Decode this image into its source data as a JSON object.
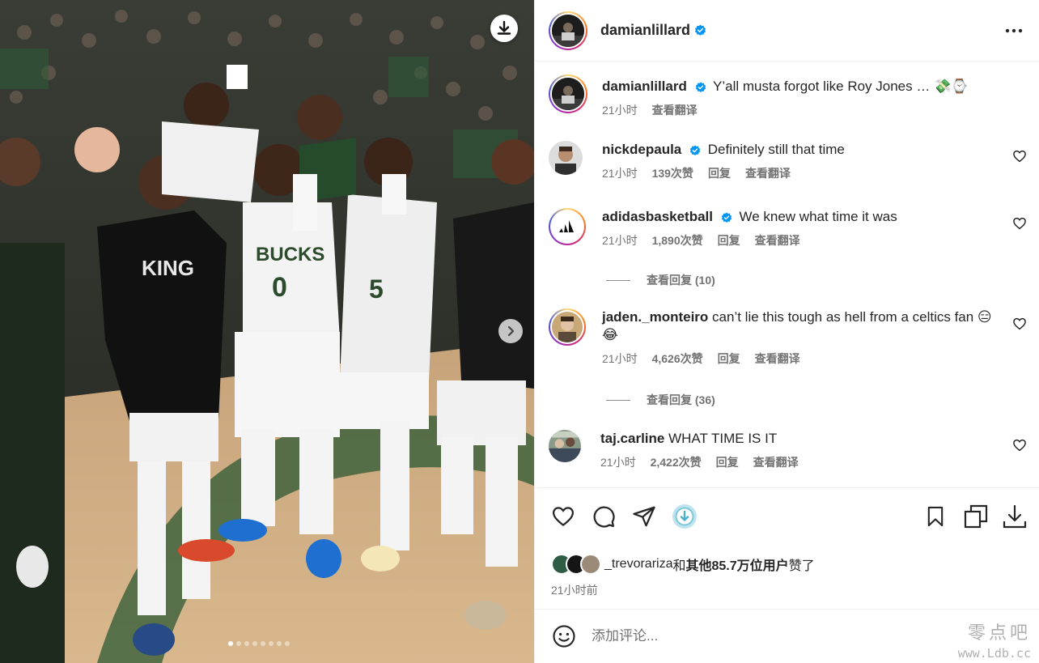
{
  "post": {
    "author": "damianlillard",
    "more_icon": "more-horizontal-icon",
    "caption": "Y’all musta forgot like Roy Jones … 💸⌚",
    "caption_time": "21小时",
    "caption_translate": "查看翻译"
  },
  "photo": {
    "alt": "Milwaukee Bucks players celebrating on court",
    "jersey_1": "BUCKS",
    "jersey_1_number": "0",
    "jersey_2_number": "5",
    "shirt_text": "KING",
    "carousel_dots": 8,
    "carousel_active": 0
  },
  "comments": [
    {
      "user": "nickdepaula",
      "verified": true,
      "text": "Definitely still that time",
      "time": "21小时",
      "likes": "139次赞",
      "reply": "回复",
      "translate": "查看翻译"
    },
    {
      "user": "adidasbasketball",
      "verified": true,
      "text": "We knew what time it was",
      "time": "21小时",
      "likes": "1,890次赞",
      "reply": "回复",
      "translate": "查看翻译",
      "view_replies": "查看回复 (10)"
    },
    {
      "user": "jaden._monteiro",
      "verified": false,
      "text": "can’t lie this tough as hell from a celtics fan 😑😂",
      "time": "21小时",
      "likes": "4,626次赞",
      "reply": "回复",
      "translate": "查看翻译",
      "view_replies": "查看回复 (36)"
    },
    {
      "user": "taj.carline",
      "verified": false,
      "text": "WHAT TIME IS IT",
      "time": "21小时",
      "likes": "2,422次赞",
      "reply": "回复",
      "translate": "查看翻译"
    }
  ],
  "actions": {
    "like_icon": "heart-icon",
    "comment_icon": "comment-icon",
    "share_icon": "send-icon",
    "download_icon": "download-circle-icon",
    "save_icon": "bookmark-icon",
    "copy_icon": "copy-icon",
    "download2_icon": "download-icon"
  },
  "likes_summary": {
    "user": "_trevorariza",
    "connector": "和",
    "others": "其他85.7万位用户",
    "suffix": "赞了"
  },
  "time_ago": "21小时前",
  "add_comment": {
    "placeholder": "添加评论..."
  },
  "watermark": {
    "line1": "零点吧",
    "line2": "www.Ldb.cc"
  },
  "colors": {
    "verified": "#0095f6",
    "meta": "#737373",
    "text": "#262626"
  }
}
